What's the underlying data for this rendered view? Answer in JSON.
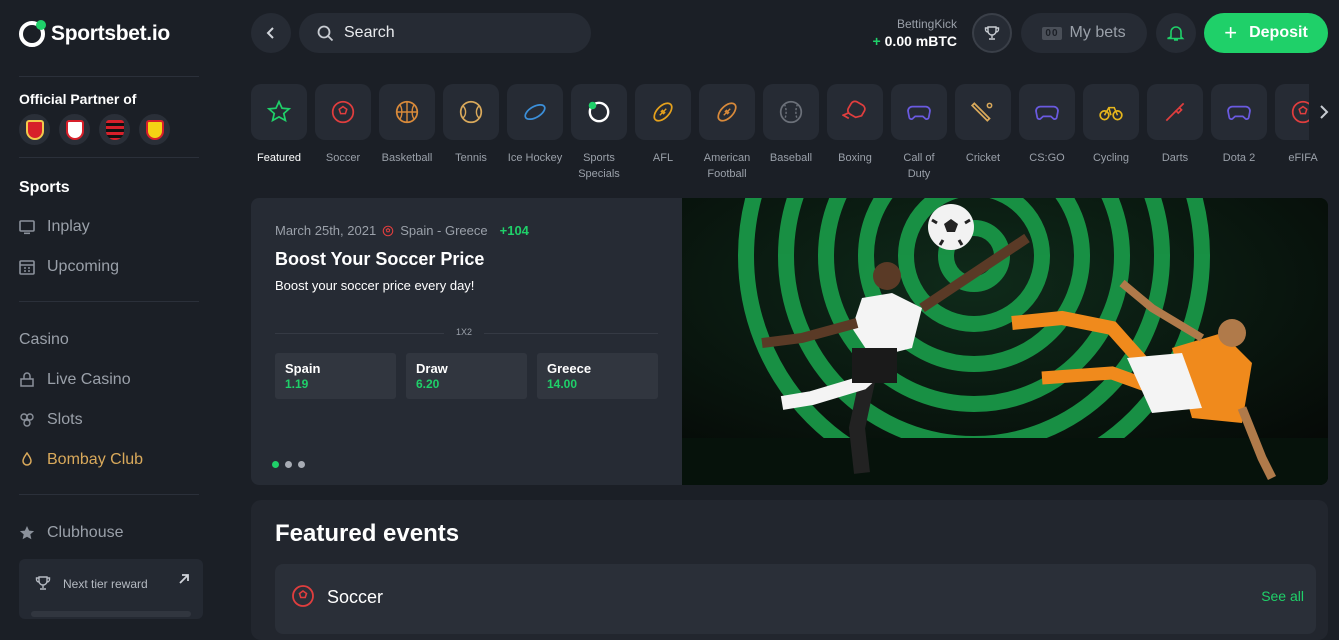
{
  "brand": {
    "name": "Sportsbet.io",
    "accent": "#1fd069"
  },
  "sidebar": {
    "partner_title": "Official Partner of",
    "clubs": [
      "arsenal-crest",
      "southampton-crest",
      "flamengo-crest",
      "watford-crest"
    ],
    "sports_heading": "Sports",
    "sports_items": [
      {
        "label": "Inplay",
        "icon": "monitor-icon"
      },
      {
        "label": "Upcoming",
        "icon": "calendar-icon"
      }
    ],
    "casino_heading": "Casino",
    "casino_items": [
      {
        "label": "Live Casino",
        "icon": "live-casino-icon"
      },
      {
        "label": "Slots",
        "icon": "slots-icon"
      },
      {
        "label": "Bombay Club",
        "icon": "bombay-club-icon"
      }
    ],
    "clubhouse": {
      "label": "Clubhouse",
      "icon": "star-icon"
    },
    "tier": {
      "label": "Next tier reward"
    }
  },
  "header": {
    "search_placeholder": "Search",
    "balance_name": "BettingKick",
    "balance_plus": "+",
    "balance_value": "0.00 mBTC",
    "mybets_badge": "00",
    "mybets_label": "My bets",
    "deposit_label": "Deposit"
  },
  "categories": [
    {
      "label": "Featured",
      "active": true
    },
    {
      "label": "Soccer"
    },
    {
      "label": "Basketball"
    },
    {
      "label": "Tennis"
    },
    {
      "label": "Ice Hockey"
    },
    {
      "label": "Sports Specials"
    },
    {
      "label": "AFL"
    },
    {
      "label": "American Football"
    },
    {
      "label": "Baseball"
    },
    {
      "label": "Boxing"
    },
    {
      "label": "Call of Duty"
    },
    {
      "label": "Cricket"
    },
    {
      "label": "CS:GO"
    },
    {
      "label": "Cycling"
    },
    {
      "label": "Darts"
    },
    {
      "label": "Dota 2"
    },
    {
      "label": "eFIFA"
    }
  ],
  "promo": {
    "date": "March 25th, 2021",
    "match": "Spain - Greece",
    "more_markets": "+104",
    "title": "Boost Your Soccer Price",
    "subtitle": "Boost your soccer price every day!",
    "market": "1X2",
    "odds": [
      {
        "name": "Spain",
        "value": "1.19"
      },
      {
        "name": "Draw",
        "value": "6.20"
      },
      {
        "name": "Greece",
        "value": "14.00"
      }
    ],
    "slides": 3,
    "active_slide": 0
  },
  "featured": {
    "title": "Featured events",
    "sport": "Soccer",
    "see_all": "See all"
  }
}
